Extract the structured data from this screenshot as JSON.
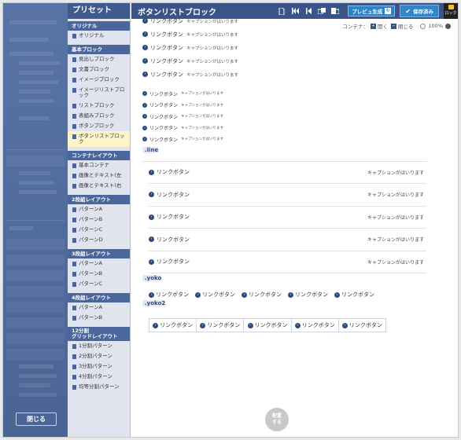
{
  "left_panel": {
    "close_label": "閉じる"
  },
  "preset": {
    "title": "プリセット",
    "sections": [
      {
        "title": "オリジナル",
        "items": [
          "オリジナル"
        ]
      },
      {
        "title": "基本ブロック",
        "items": [
          "見出しブロック",
          "文書ブロック",
          "イメージブロック",
          "イメージリストブロック",
          "リストブロック",
          "表組みブロック",
          "ボタンブロック",
          "ボタンリストブロック"
        ]
      },
      {
        "title": "コンテナレイアウト",
        "items": [
          "基本コンテナ",
          "画像とテキスト(左",
          "画像とテキスト(右"
        ]
      },
      {
        "title": "2段組レイアウト",
        "items": [
          "パターンA",
          "パターンB",
          "パターンC",
          "パターンD"
        ]
      },
      {
        "title": "3段組レイアウト",
        "items": [
          "パターンA",
          "パターンB",
          "パターンC"
        ]
      },
      {
        "title": "4段組レイアウト",
        "items": [
          "パターンA",
          "パターンB"
        ]
      },
      {
        "title": "12分割\nグリッドレイアウト",
        "items": [
          "1分割パターン",
          "2分割パターン",
          "3分割パターン",
          "4分割パターン",
          "均等分割パターン"
        ]
      }
    ]
  },
  "toolbar": {
    "title": "ボタンリストブロック",
    "preview_label": "プレビュ生成",
    "save_label": "保存済み",
    "lock_label": "ロック"
  },
  "container_bar": {
    "label": "コンテナ：",
    "open": "開く",
    "close": "閉じる",
    "zoom": "100%"
  },
  "canvas": {
    "link_label": "リンクボタン",
    "caption": "キャプションがはいります",
    "line_label": ".line",
    "yoko_label": ".yoko",
    "yoko2_label": ".yoko2"
  },
  "place_button": "配置\nする"
}
